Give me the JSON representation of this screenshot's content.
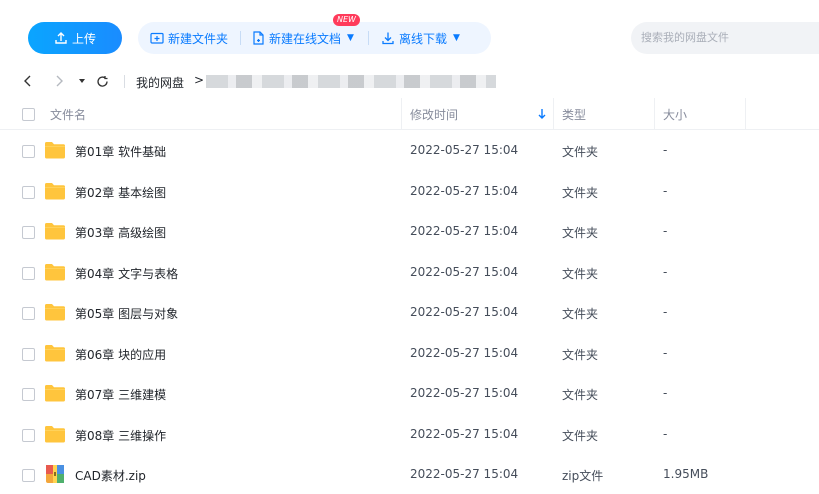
{
  "toolbar": {
    "upload_label": "上传",
    "new_folder_label": "新建文件夹",
    "new_doc_label": "新建在线文档",
    "new_badge": "NEW",
    "offline_download_label": "离线下载",
    "search_placeholder": "搜索我的网盘文件"
  },
  "nav": {
    "root_crumb": "我的网盘",
    "crumb_separator": ">"
  },
  "table": {
    "headers": {
      "name": "文件名",
      "modified": "修改时间",
      "type": "类型",
      "size": "大小"
    },
    "rows": [
      {
        "name": "第01章 软件基础",
        "time": "2022-05-27 15:04",
        "type": "文件夹",
        "size": "-",
        "icon": "folder-icon"
      },
      {
        "name": "第02章 基本绘图",
        "time": "2022-05-27 15:04",
        "type": "文件夹",
        "size": "-",
        "icon": "folder-icon"
      },
      {
        "name": "第03章 高级绘图",
        "time": "2022-05-27 15:04",
        "type": "文件夹",
        "size": "-",
        "icon": "folder-icon"
      },
      {
        "name": "第04章 文字与表格",
        "time": "2022-05-27 15:04",
        "type": "文件夹",
        "size": "-",
        "icon": "folder-icon"
      },
      {
        "name": "第05章 图层与对象",
        "time": "2022-05-27 15:04",
        "type": "文件夹",
        "size": "-",
        "icon": "folder-icon"
      },
      {
        "name": "第06章 块的应用",
        "time": "2022-05-27 15:04",
        "type": "文件夹",
        "size": "-",
        "icon": "folder-icon"
      },
      {
        "name": "第07章 三维建模",
        "time": "2022-05-27 15:04",
        "type": "文件夹",
        "size": "-",
        "icon": "folder-icon"
      },
      {
        "name": "第08章 三维操作",
        "time": "2022-05-27 15:04",
        "type": "文件夹",
        "size": "-",
        "icon": "folder-icon"
      },
      {
        "name": "CAD素材.zip",
        "time": "2022-05-27 15:04",
        "type": "zip文件",
        "size": "1.95MB",
        "icon": "zip-icon"
      }
    ]
  },
  "colors": {
    "accent": "#0a7bff",
    "folder": "#ffc53d",
    "new_badge": "#ff3b5b"
  }
}
